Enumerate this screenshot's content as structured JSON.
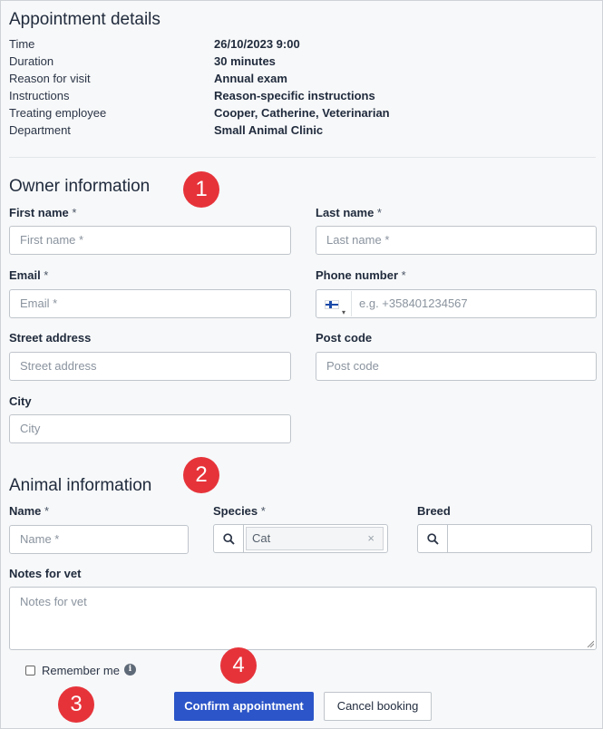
{
  "appointment": {
    "title": "Appointment details",
    "rows": [
      {
        "label": "Time",
        "value": "26/10/2023 9:00"
      },
      {
        "label": "Duration",
        "value": "30 minutes"
      },
      {
        "label": "Reason for visit",
        "value": "Annual exam"
      },
      {
        "label": "Instructions",
        "value": "Reason-specific instructions"
      },
      {
        "label": "Treating employee",
        "value": "Cooper, Catherine, Veterinarian"
      },
      {
        "label": "Department",
        "value": "Small Animal Clinic"
      }
    ]
  },
  "owner": {
    "title": "Owner information",
    "first_name": {
      "label": "First name",
      "req": " *",
      "placeholder": "First name *"
    },
    "last_name": {
      "label": "Last name",
      "req": " *",
      "placeholder": "Last name *"
    },
    "email": {
      "label": "Email",
      "req": " *",
      "placeholder": "Email *"
    },
    "phone": {
      "label": "Phone number",
      "req": " *",
      "placeholder": "e.g. +358401234567",
      "flag_caret": "▾"
    },
    "street": {
      "label": "Street address",
      "placeholder": "Street address"
    },
    "post_code": {
      "label": "Post code",
      "placeholder": "Post code"
    },
    "city": {
      "label": "City",
      "placeholder": "City"
    }
  },
  "animal": {
    "title": "Animal information",
    "name": {
      "label": "Name",
      "req": " *",
      "placeholder": "Name *"
    },
    "species": {
      "label": "Species",
      "req": " *",
      "value": "Cat",
      "clear": "×"
    },
    "breed": {
      "label": "Breed",
      "value": ""
    },
    "notes": {
      "label": "Notes for vet",
      "placeholder": "Notes for vet"
    }
  },
  "remember": {
    "label": "Remember me",
    "info": "i"
  },
  "actions": {
    "confirm": "Confirm appointment",
    "cancel": "Cancel booking"
  },
  "badges": [
    "1",
    "2",
    "3",
    "4"
  ],
  "colors": {
    "badge": "#e6333a",
    "primary": "#2b55c8"
  }
}
